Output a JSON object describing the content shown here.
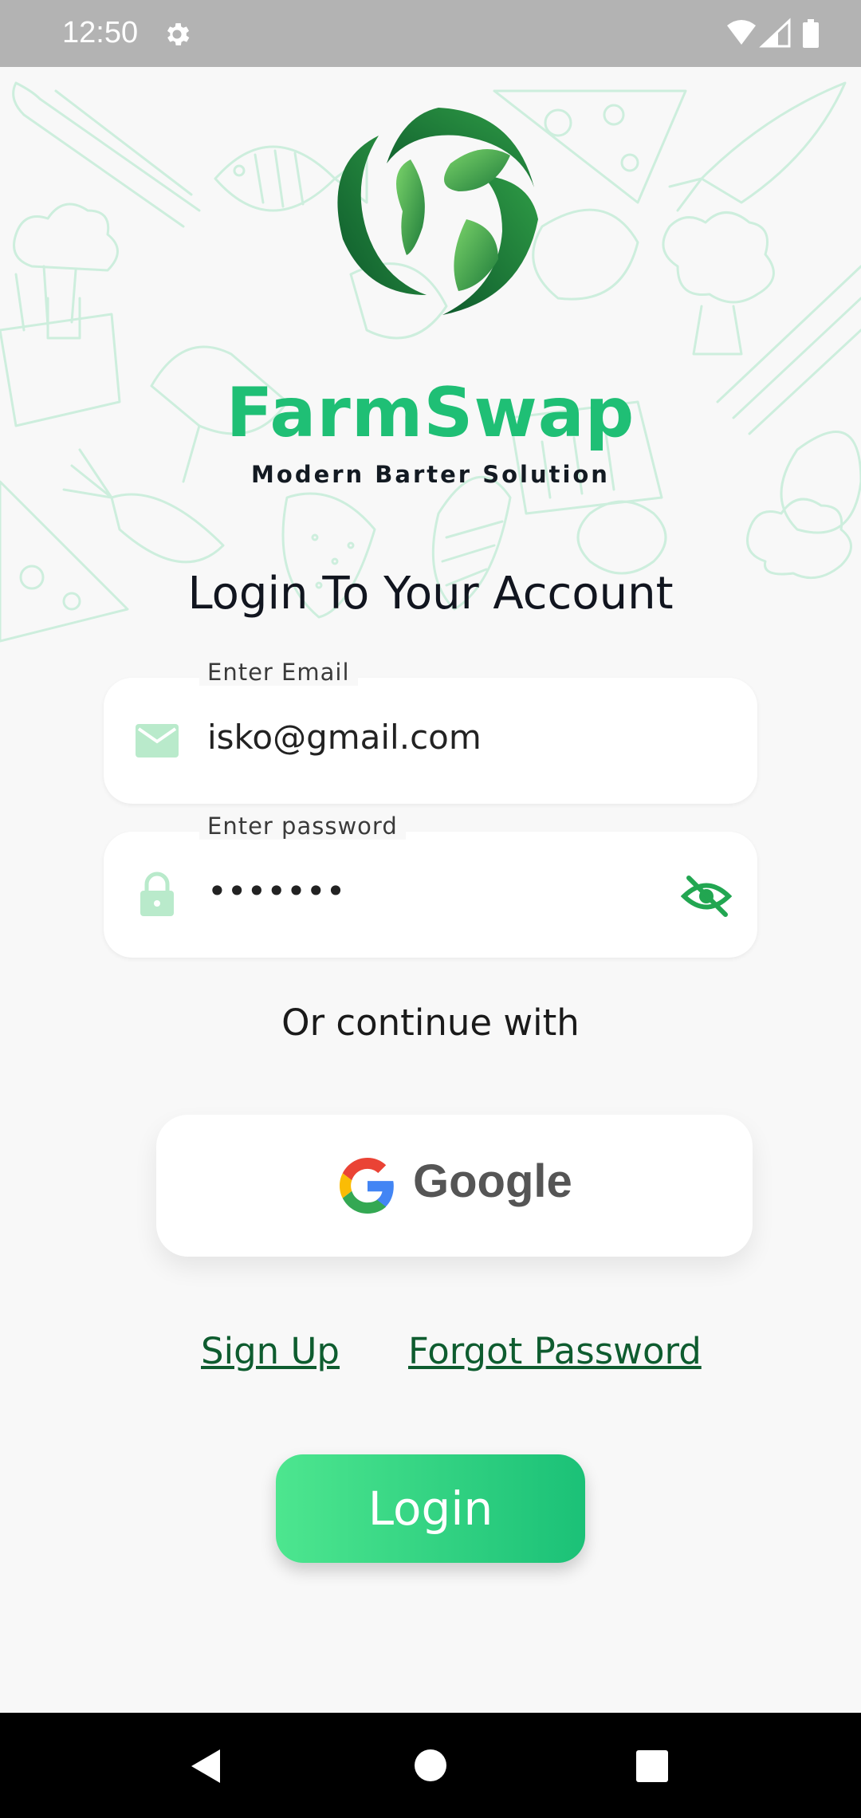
{
  "status_bar": {
    "time": "12:50",
    "icons": [
      "gear-icon",
      "wifi-icon",
      "signal-icon",
      "battery-icon"
    ]
  },
  "app": {
    "title": "FarmSwap",
    "subtitle": "Modern Barter Solution",
    "brand_color": "#1fbf75"
  },
  "login": {
    "heading": "Login To Your Account",
    "email": {
      "label": "Enter Email",
      "value": "isko@gmail.com",
      "icon": "mail-icon"
    },
    "password": {
      "label": "Enter password",
      "value": "•••••••",
      "icon": "lock-icon",
      "toggle_icon": "eye-off-icon"
    },
    "or_text": "Or continue with",
    "google_label": "Google",
    "signup_label": "Sign Up",
    "forgot_label": "Forgot Password",
    "login_label": "Login"
  },
  "nav": {
    "icons": [
      "back-icon",
      "home-icon",
      "recents-icon"
    ]
  }
}
